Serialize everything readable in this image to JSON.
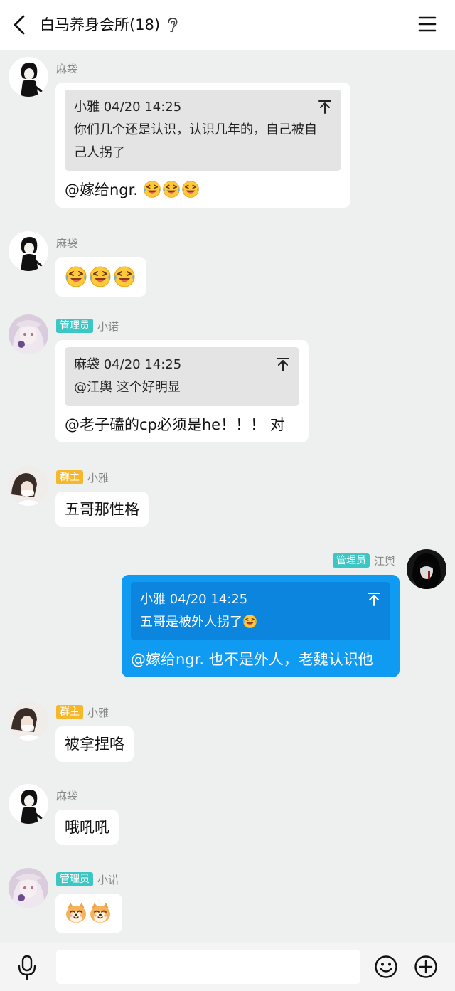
{
  "header": {
    "title": "白马养身会所(18)"
  },
  "messages": [
    {
      "sender": "麻袋",
      "quote_head": "小雅 04/20 14:25",
      "quote_body": "你们几个还是认识，认识几年的，自己被自己人拐了",
      "text": "@嫁给ngr. "
    },
    {
      "sender": "麻袋"
    },
    {
      "badge": "管理员",
      "sender": "小诺",
      "quote_head": "麻袋 04/20 14:25",
      "quote_body": "@江舆 这个好明显",
      "text": "@老子磕的cp必须是he！！！ 对"
    },
    {
      "badge": "群主",
      "sender": "小雅",
      "text": "五哥那性格"
    },
    {
      "badge": "管理员",
      "sender": "江舆",
      "quote_head": "小雅 04/20 14:25",
      "quote_body": "五哥是被外人拐了",
      "text": "@嫁给ngr. 也不是外人，老魏认识他"
    },
    {
      "badge": "群主",
      "sender": "小雅",
      "text": "被拿捏咯"
    },
    {
      "sender": "麻袋",
      "text": "哦吼吼"
    },
    {
      "badge": "管理员",
      "sender": "小诺"
    }
  ],
  "emoji": {
    "laugh": "laughing-tears-emoji",
    "doge": "shiba-doge-emoji"
  },
  "input": {
    "value": "",
    "placeholder": ""
  },
  "colors": {
    "self_bubble": "#0f9bf2",
    "admin_badge": "#3cc6c4",
    "owner_badge": "#f5b82c"
  }
}
